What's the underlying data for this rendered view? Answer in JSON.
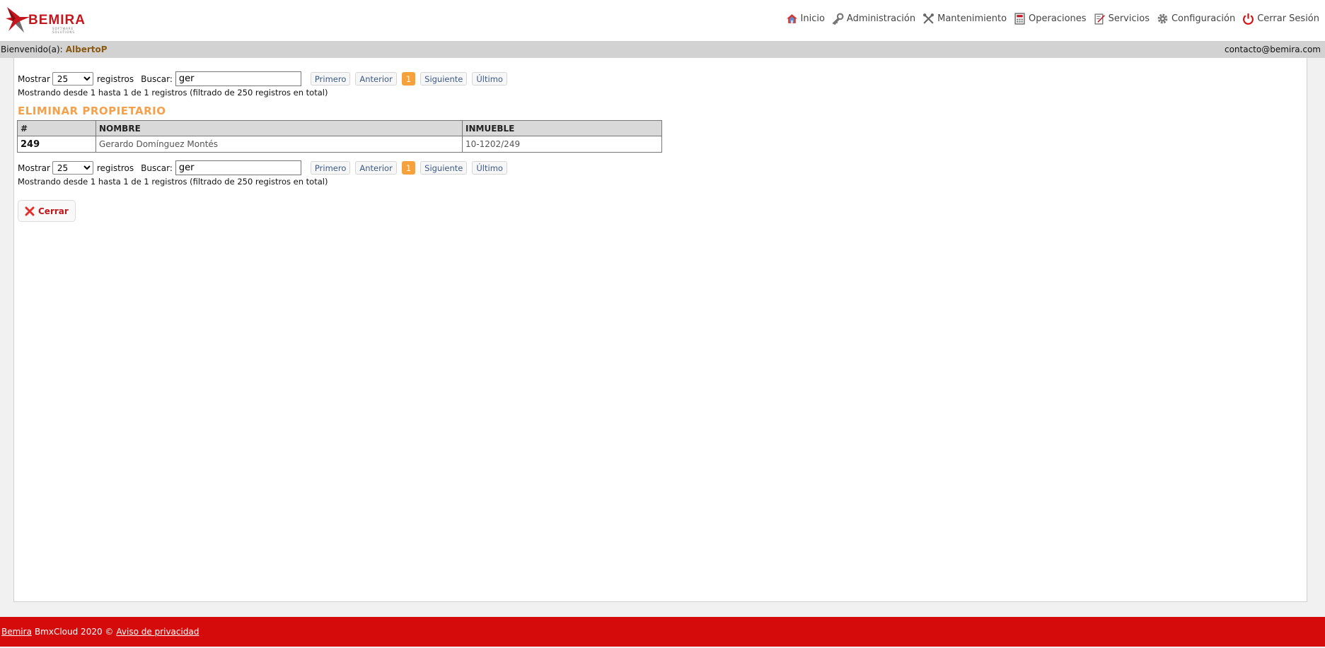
{
  "brand": {
    "name": "BEMIRA",
    "tagline": "SOFTWARE SOLUTIONS",
    "accent": "#c4161c"
  },
  "nav": [
    {
      "label": "Inicio",
      "icon": "home-icon"
    },
    {
      "label": "Administración",
      "icon": "key-icon"
    },
    {
      "label": "Mantenimiento",
      "icon": "tools-icon"
    },
    {
      "label": "Operaciones",
      "icon": "calculator-icon"
    },
    {
      "label": "Servicios",
      "icon": "edit-document-icon"
    },
    {
      "label": "Configuración",
      "icon": "gear-icon"
    },
    {
      "label": "Cerrar Sesión",
      "icon": "power-icon"
    }
  ],
  "welcome": {
    "prefix": "Bienvenido(a):",
    "user": "AlbertoP",
    "contact": "contacto@bemira.com"
  },
  "datatable": {
    "show_label": "Mostrar",
    "page_size": "25",
    "records_label": "registros",
    "search_label": "Buscar:",
    "search_value": "ger",
    "pager": {
      "first": "Primero",
      "prev": "Anterior",
      "current": "1",
      "next": "Siguiente",
      "last": "Último"
    },
    "info": "Mostrando desde 1 hasta 1 de 1 registros (filtrado de 250 registros en total)"
  },
  "page": {
    "title": "ELIMINAR PROPIETARIO"
  },
  "table": {
    "headers": [
      "#",
      "NOMBRE",
      "INMUEBLE"
    ],
    "rows": [
      {
        "id": "249",
        "nombre": "Gerardo Domínguez Montés",
        "inmueble": "10-1202/249"
      }
    ]
  },
  "actions": {
    "close_label": "Cerrar"
  },
  "footer": {
    "brand_link": "Bemira",
    "product": "BmxCloud 2020 ©",
    "privacy_link": "Aviso de privacidad"
  },
  "colors": {
    "title": "#f5a04a",
    "footer": "#d50a0a",
    "active_page": "#f6a13a"
  }
}
